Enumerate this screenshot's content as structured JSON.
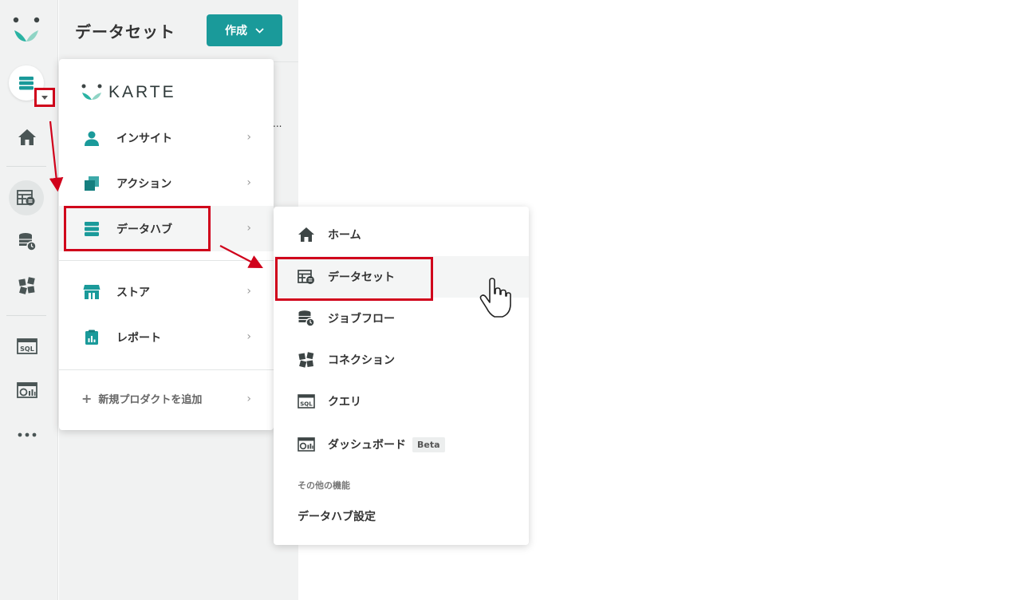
{
  "side": {
    "title": "データセット",
    "create_label": "作成",
    "ellipsis": "..."
  },
  "menu1": {
    "brand": "KARTE",
    "items": [
      {
        "label": "インサイト",
        "icon": "person-icon"
      },
      {
        "label": "アクション",
        "icon": "action-icon"
      },
      {
        "label": "データハブ",
        "icon": "datahub-icon"
      },
      {
        "label": "ストア",
        "icon": "store-icon"
      },
      {
        "label": "レポート",
        "icon": "report-icon"
      }
    ],
    "add_label": "新規プロダクトを追加"
  },
  "menu2": {
    "items": [
      {
        "label": "ホーム",
        "icon": "home-icon"
      },
      {
        "label": "データセット",
        "icon": "dataset-icon"
      },
      {
        "label": "ジョブフロー",
        "icon": "jobflow-icon"
      },
      {
        "label": "コネクション",
        "icon": "connection-icon"
      },
      {
        "label": "クエリ",
        "icon": "sql-icon"
      },
      {
        "label": "ダッシュボード",
        "icon": "dashboard-icon"
      }
    ],
    "beta": "Beta",
    "section": "その他の機能",
    "settings": "データハブ設定"
  },
  "icons": {
    "sql_text": "SQL"
  },
  "colors": {
    "accent": "#1a9a9a",
    "highlight": "#d0021b",
    "icon_dark": "#4a5555"
  }
}
